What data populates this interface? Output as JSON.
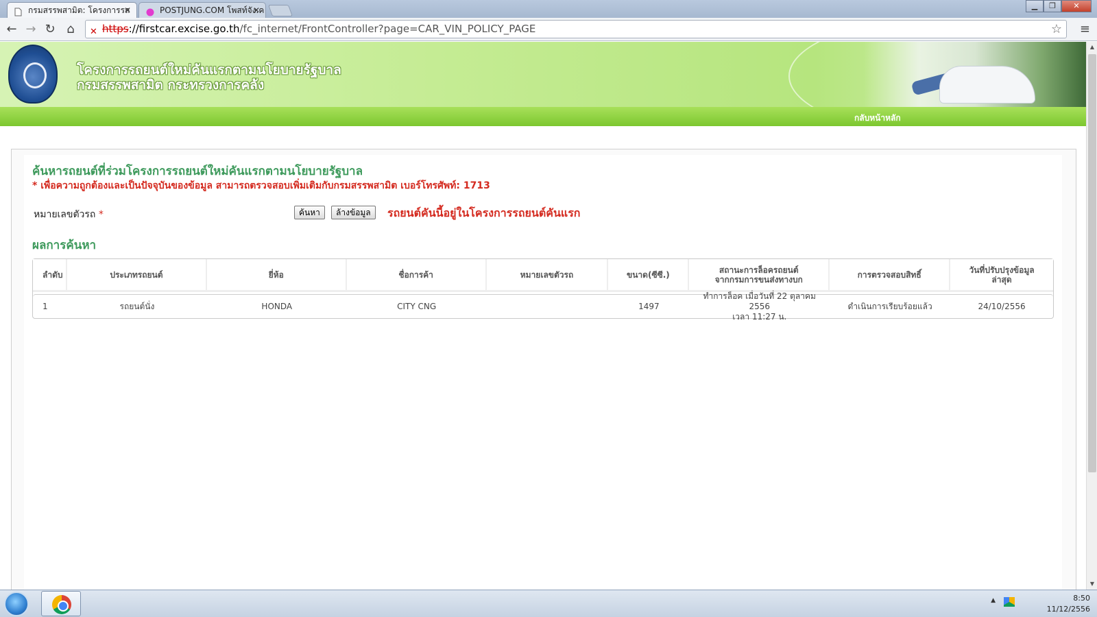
{
  "browser": {
    "tabs": [
      {
        "title": "กรมสรรพสามิต: โครงการรถ",
        "active": true
      },
      {
        "title": "POSTJUNG.COM โพสท์จัง.ค",
        "active": false
      }
    ],
    "url_scheme": "https",
    "url_host": "://firstcar.excise.go.th",
    "url_path": "/fc_internet/FrontController?page=CAR_VIN_POLICY_PAGE"
  },
  "header": {
    "title_line1": "โครงการรถยนต์ใหม่คันแรกตามนโยบายรัฐบาล",
    "title_line2": "กรมสรรพสามิต กระทรวงการคลัง",
    "nav_home": "กลับหน้าหลัก"
  },
  "search": {
    "heading": "ค้นหารถยนต์ที่ร่วมโครงการรถยนต์ใหม่คันแรกตามนโยบายรัฐบาล",
    "note": "* เพื่อความถูกต้องและเป็นปัจจุบันของข้อมูล สามารถตรวจสอบเพิ่มเติมกับกรมสรรพสามิต เบอร์โทรศัพท์: 1713",
    "field_label": "หมายเลขตัวรถ",
    "required_mark": "*",
    "search_button": "ค้นหา",
    "clear_button": "ล้างข้อมูล",
    "result_message": "รถยนต์คันนี้อยู่ในโครงการรถยนต์คันแรก"
  },
  "results": {
    "heading": "ผลการค้นหา",
    "columns": [
      "ลำดับ",
      "ประเภทรถยนต์",
      "ยี่ห้อ",
      "ชื่อการค้า",
      "หมายเลขตัวรถ",
      "ขนาด(ซีซี.)",
      "สถานะการล็อครถยนต์\nจากกรมการขนส่งทางบก",
      "การตรวจสอบสิทธิ์",
      "วันที่ปรับปรุงข้อมูล\nล่าสุด"
    ],
    "rows": [
      [
        "1",
        "รถยนต์นั่ง",
        "HONDA",
        "CITY CNG",
        "",
        "1497",
        "ทำการล็อค เมื่อวันที่ 22 ตุลาคม 2556\nเวลา 11:27 น.",
        "ดำเนินการเรียบร้อยแล้ว",
        "24/10/2556"
      ]
    ]
  },
  "taskbar": {
    "time": "8:50",
    "date": "11/12/2556"
  },
  "icons": [
    "page-icon",
    "close-icon",
    "back-icon",
    "forward-icon",
    "reload-icon",
    "home-icon",
    "insecure-lock-icon",
    "star-icon",
    "menu-icon",
    "seal-icon",
    "windows-start-icon",
    "chrome-icon",
    "google-drive-icon"
  ]
}
